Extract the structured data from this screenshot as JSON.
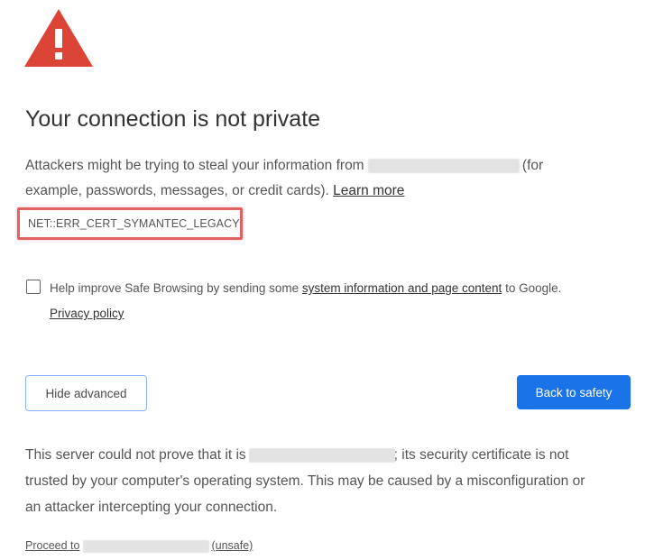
{
  "warning_icon": {
    "name": "warning-triangle-icon",
    "color": "#db4437"
  },
  "title": "Your connection is not private",
  "main_message": {
    "part1": "Attackers might be trying to steal your information from",
    "part2": "(for",
    "part3": "example, passwords, messages, or credit cards).",
    "learn_more": "Learn more"
  },
  "error_code": "NET::ERR_CERT_SYMANTEC_LEGACY",
  "safe_browsing": {
    "text_before": "Help improve Safe Browsing by sending some",
    "link": "system information and page content",
    "text_after": "to Google.",
    "privacy_policy": "Privacy policy",
    "checked": false
  },
  "buttons": {
    "hide_advanced": "Hide advanced",
    "back_to_safety": "Back to safety"
  },
  "details": {
    "part1": "This server could not prove that it is",
    "part2": "; its security certificate is not",
    "line2": "trusted by your computer's operating system. This may be caused by a misconfiguration or",
    "line3": "an attacker intercepting your connection."
  },
  "proceed": {
    "prefix": "Proceed to",
    "suffix": "(unsafe)"
  },
  "colors": {
    "primary_button": "#1a73e8",
    "error_highlight": "#e06262",
    "warning_red": "#db4437"
  }
}
